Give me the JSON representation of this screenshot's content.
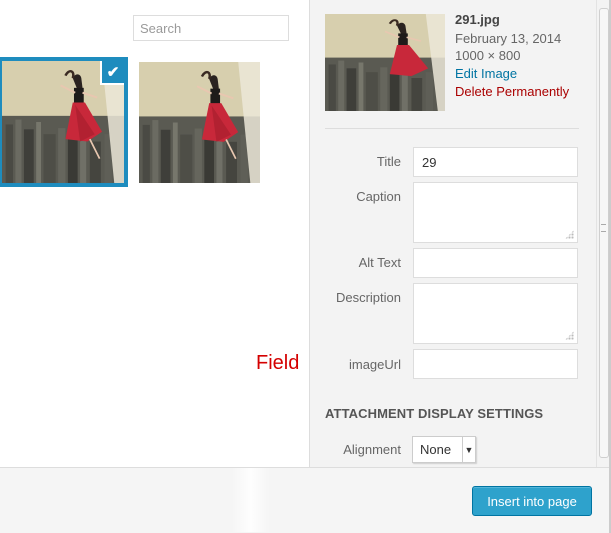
{
  "search": {
    "placeholder": "Search"
  },
  "attachment": {
    "filename": "291.jpg",
    "date": "February 13, 2014",
    "dimensions": "1000 × 800",
    "edit_label": "Edit Image",
    "delete_label": "Delete Permanently"
  },
  "fields": {
    "title_label": "Title",
    "title_value": "29",
    "caption_label": "Caption",
    "caption_value": "",
    "alt_label": "Alt Text",
    "alt_value": "",
    "description_label": "Description",
    "description_value": "",
    "imageurl_label": "imageUrl",
    "imageurl_value": ""
  },
  "annotation": {
    "text": "Field",
    "color": "#d40000"
  },
  "display_settings": {
    "heading": "ATTACHMENT DISPLAY SETTINGS",
    "alignment_label": "Alignment",
    "alignment_value": "None"
  },
  "footer": {
    "insert_label": "Insert into page"
  },
  "colors": {
    "accent": "#1e8cbe",
    "button": "#2ea2cc",
    "link": "#0074a2",
    "danger": "#aa0000"
  },
  "icons": {
    "selected_check": "checkmark-icon",
    "resize": "resize-grip-icon",
    "dropdown": "dropdown-arrow-icon"
  }
}
